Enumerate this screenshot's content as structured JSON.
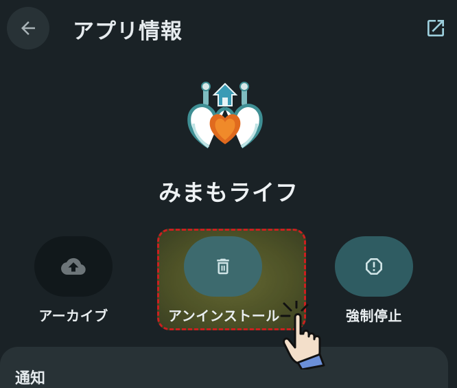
{
  "header": {
    "title": "アプリ情報",
    "back_icon": "arrow-left-icon",
    "open_icon": "open-in-new-icon"
  },
  "app": {
    "name": "みまもライフ",
    "icon": "heart-home-app-icon"
  },
  "actions": [
    {
      "label": "アーカイブ",
      "icon": "cloud-upload-icon"
    },
    {
      "label": "アンインストール",
      "icon": "trash-icon"
    },
    {
      "label": "強制停止",
      "icon": "alert-octagon-icon"
    }
  ],
  "section": {
    "label": "通知"
  },
  "colors": {
    "background": "#1a2226",
    "uninstall_button": "#3d6a6e",
    "forcestop_button": "#2f5c62",
    "highlight_border": "#cc1f1f"
  }
}
